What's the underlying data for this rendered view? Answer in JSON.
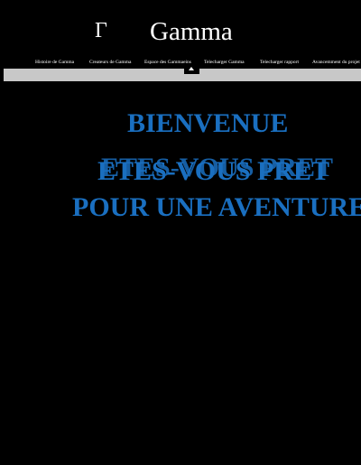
{
  "header": {
    "logo_glyph": "Γ",
    "title": "Gamma"
  },
  "nav": {
    "items": [
      "Histoire de Gamma",
      "Createurs de Gamma",
      "Espace des Gammaeins",
      "Telecharger Gamma",
      "Telecharger rapport",
      "Avancemment du projet"
    ],
    "toggle_icon": "caret-up-icon"
  },
  "hero": {
    "line1": "BIENVENUE",
    "line2": "ETES-VOUS PRET",
    "line3": "POUR UNE AVENTURE"
  },
  "colors": {
    "background": "#000000",
    "nav_bar": "#c8c8c8",
    "hero_text": "#1a6fc0",
    "header_text": "#ffffff"
  }
}
